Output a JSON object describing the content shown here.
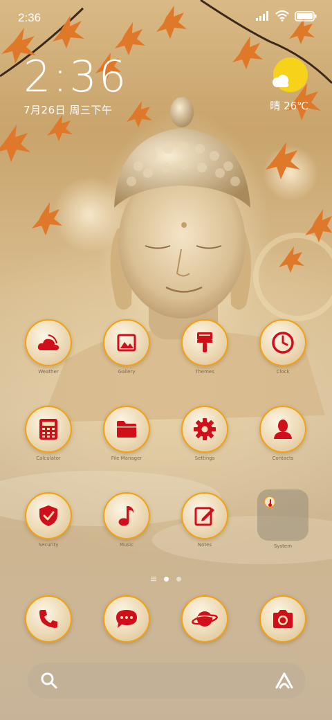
{
  "status_bar": {
    "time": "2:36"
  },
  "clock_widget": {
    "time": "2:36",
    "date": "7月26日 周三下午"
  },
  "weather_widget": {
    "condition_temp": "晴 26℃"
  },
  "apps": [
    {
      "label": "Weather",
      "icon": "weather-icon"
    },
    {
      "label": "Gallery",
      "icon": "gallery-icon"
    },
    {
      "label": "Themes",
      "icon": "themes-icon"
    },
    {
      "label": "Clock",
      "icon": "clock-icon"
    },
    {
      "label": "Calculator",
      "icon": "calculator-icon"
    },
    {
      "label": "File Manager",
      "icon": "folder-icon"
    },
    {
      "label": "Settings",
      "icon": "gear-icon"
    },
    {
      "label": "Contacts",
      "icon": "contact-icon"
    },
    {
      "label": "Security",
      "icon": "shield-icon"
    },
    {
      "label": "Music",
      "icon": "music-note-icon"
    },
    {
      "label": "Notes",
      "icon": "notes-icon"
    },
    {
      "label": "System",
      "icon": "folder-group"
    }
  ],
  "dock": [
    {
      "icon": "phone-icon"
    },
    {
      "icon": "messages-icon"
    },
    {
      "icon": "browser-planet-icon"
    },
    {
      "icon": "camera-icon"
    }
  ],
  "colors": {
    "icon_red": "#d10f1b",
    "ring": "#f2a10f",
    "sun": "#f7d21b"
  }
}
